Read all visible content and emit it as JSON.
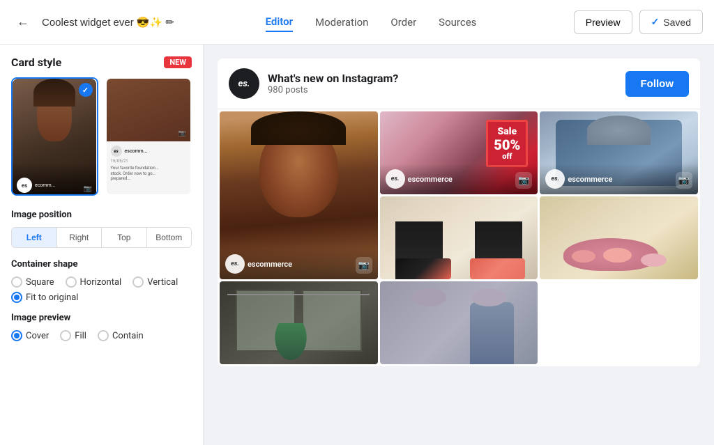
{
  "topbar": {
    "back_icon": "←",
    "title": "Coolest widget ever",
    "title_emoji": "😎✨",
    "edit_icon": "✏",
    "tabs": [
      {
        "id": "editor",
        "label": "Editor",
        "active": true
      },
      {
        "id": "moderation",
        "label": "Moderation",
        "active": false
      },
      {
        "id": "order",
        "label": "Order",
        "active": false
      },
      {
        "id": "sources",
        "label": "Sources",
        "active": false
      }
    ],
    "preview_label": "Preview",
    "saved_label": "Saved",
    "check_icon": "✓"
  },
  "sidebar": {
    "card_style_label": "Card style",
    "new_badge": "NEW",
    "image_position_label": "Image position",
    "position_buttons": [
      {
        "id": "left",
        "label": "Left",
        "active": true
      },
      {
        "id": "right",
        "label": "Right",
        "active": false
      },
      {
        "id": "top",
        "label": "Top",
        "active": false
      },
      {
        "id": "bottom",
        "label": "Bottom",
        "active": false
      }
    ],
    "container_shape_label": "Container shape",
    "container_options": [
      {
        "id": "square",
        "label": "Square",
        "checked": false
      },
      {
        "id": "horizontal",
        "label": "Horizontal",
        "checked": false
      },
      {
        "id": "vertical",
        "label": "Vertical",
        "checked": false
      },
      {
        "id": "fit",
        "label": "Fit to original",
        "checked": true
      }
    ],
    "image_preview_label": "Image preview",
    "preview_options": [
      {
        "id": "cover",
        "label": "Cover",
        "checked": true
      },
      {
        "id": "fill",
        "label": "Fill",
        "checked": false
      },
      {
        "id": "contain",
        "label": "Contain",
        "checked": false
      }
    ]
  },
  "widget": {
    "logo_text": "es.",
    "title": "What's new on Instagram?",
    "subtitle": "980 posts",
    "follow_label": "Follow",
    "logo_username": "es.",
    "username": "escommerce",
    "grid_items": [
      {
        "id": 1,
        "type": "portrait",
        "show_logo": true,
        "show_icon": true
      },
      {
        "id": 2,
        "type": "sale",
        "show_logo": true,
        "show_icon": true,
        "sale_text": "Sale\n50%\noff"
      },
      {
        "id": 3,
        "type": "fashion",
        "show_logo": true,
        "show_icon": true
      },
      {
        "id": 4,
        "type": "shoes",
        "show_logo": false,
        "show_icon": false
      },
      {
        "id": 5,
        "type": "fashion2",
        "show_logo": true,
        "show_icon": true
      },
      {
        "id": 6,
        "type": "window",
        "show_logo": false,
        "show_icon": false
      },
      {
        "id": 7,
        "type": "flowers",
        "show_logo": false,
        "show_icon": false
      },
      {
        "id": 8,
        "type": "people",
        "show_logo": false,
        "show_icon": false
      }
    ]
  }
}
